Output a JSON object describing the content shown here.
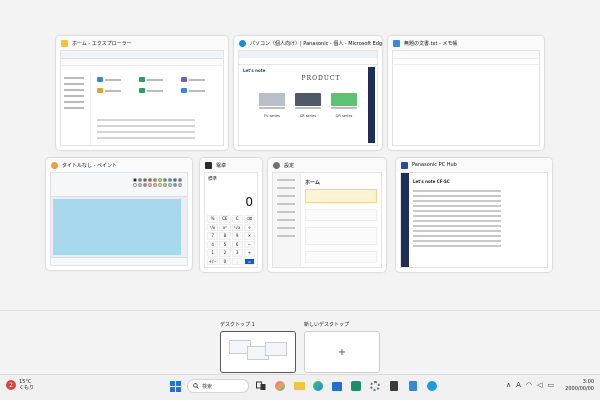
{
  "windows": [
    {
      "title": "ホーム - エクスプローラー",
      "icon": "file-explorer-icon",
      "color": "#f2c43b"
    },
    {
      "title": "パソコン（個人向け）| Panasonic - 個人 - Microsoft Edge",
      "icon": "edge-icon",
      "color": "#1d8bd1"
    },
    {
      "title": "無題の文書.txt - メモ帳",
      "icon": "notepad-icon",
      "color": "#3a88d6"
    },
    {
      "title": "タイトルなし - ペイント",
      "icon": "paint-icon",
      "color": "#e8a23a"
    },
    {
      "title": "電卓",
      "icon": "calculator-icon",
      "color": "#2b2b2b"
    },
    {
      "title": "設定",
      "icon": "settings-gear-icon",
      "color": "#707070"
    },
    {
      "title": "Panasonic PC Hub",
      "icon": "pc-hub-icon",
      "color": "#1f4e9c"
    }
  ],
  "edge_page": {
    "brand": "Let's note",
    "heading": "PRODUCT",
    "products": [
      "FV series",
      "SR series",
      "QR series"
    ],
    "product_colors": [
      "#b9bfc8",
      "#4f5a66",
      "#5cc276"
    ]
  },
  "settings_page": {
    "home": "ホーム"
  },
  "hub_page": {
    "model": "Let's note CF-SC"
  },
  "calc": {
    "mode": "標準",
    "display": "0",
    "keys": [
      "%",
      "CE",
      "C",
      "⌫",
      "¹/x",
      "x²",
      "²√x",
      "÷",
      "7",
      "8",
      "9",
      "×",
      "4",
      "5",
      "6",
      "−",
      "1",
      "2",
      "3",
      "+",
      "+/−",
      "0",
      ".",
      "="
    ]
  },
  "paint_colors": [
    "#000000",
    "#7f7f7f",
    "#c32b2b",
    "#ee2c2c",
    "#f57a21",
    "#fcd116",
    "#22b14c",
    "#00a2e8",
    "#3f48cc",
    "#a349a4",
    "#ffffff",
    "#c3c3c3",
    "#b97a57",
    "#ffaec9",
    "#ffc90e",
    "#efe4b0",
    "#b5e61d",
    "#99d9ea",
    "#7092be",
    "#c8bfe7"
  ],
  "desktops": [
    {
      "label": "デスクトップ 1",
      "active": true
    },
    {
      "label": "新しいデスクトップ",
      "active": false,
      "add_symbol": "+"
    }
  ],
  "taskbar": {
    "weather_badge": "2",
    "temperature": "15°C",
    "condition": "くもり",
    "search_placeholder": "検索",
    "ime_indicator": "A",
    "time": "3:00",
    "date": "2000/00/00",
    "pinned_icons": [
      "start-icon",
      "task-view-icon",
      "copilot-icon",
      "file-explorer-icon",
      "edge-icon",
      "store-icon",
      "app-icon",
      "settings-icon",
      "calculator-icon",
      "notepad-icon",
      "pc-hub-icon"
    ]
  }
}
